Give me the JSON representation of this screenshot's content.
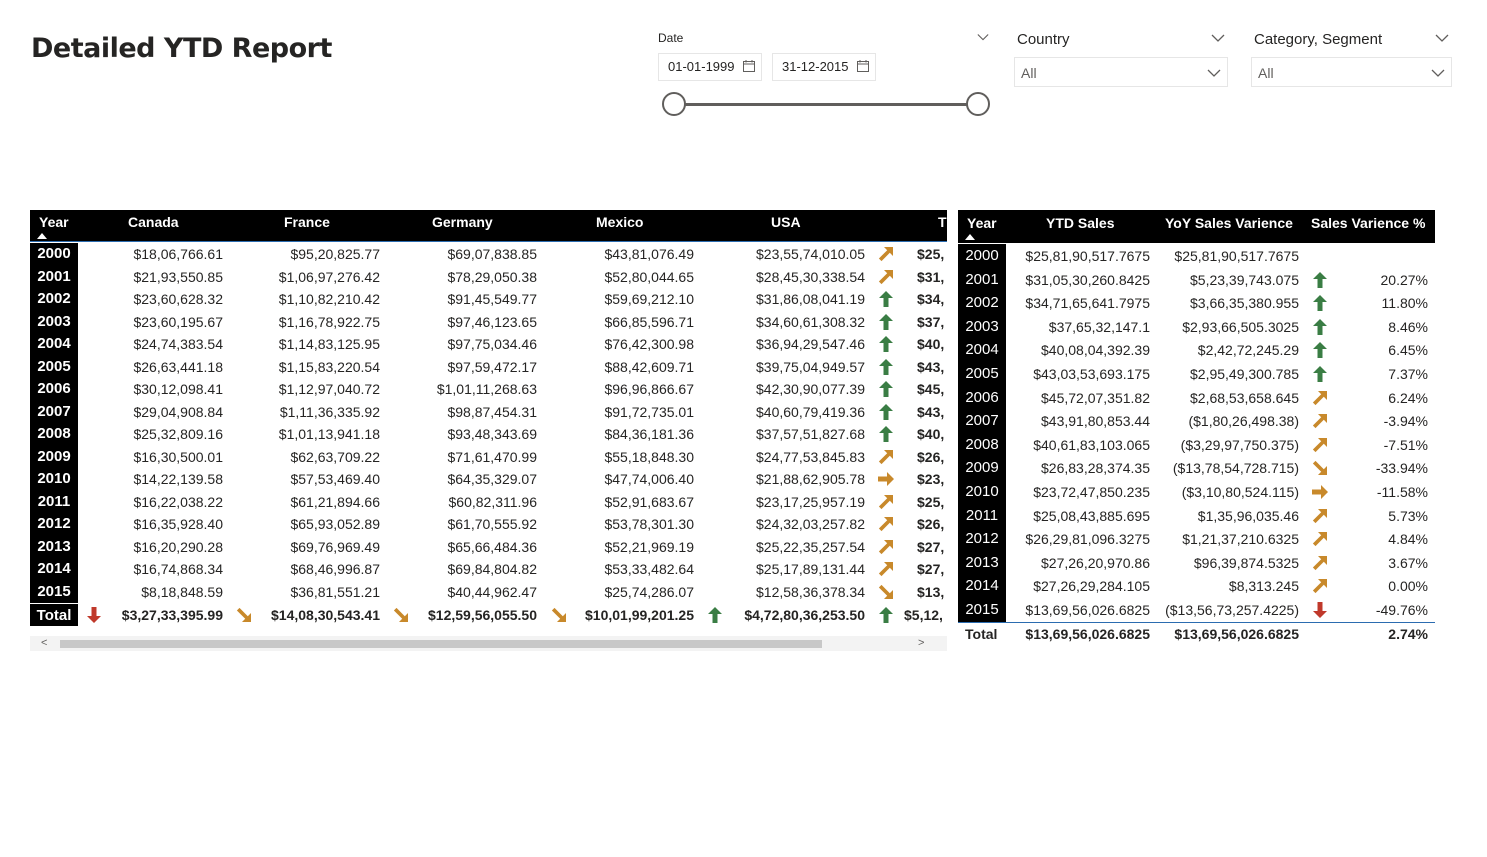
{
  "page_title": "Detailed YTD Report",
  "date_slicer": {
    "label": "Date",
    "start": "01-01-1999",
    "end": "31-12-2015"
  },
  "country_slicer": {
    "label": "Country",
    "value": "All"
  },
  "category_slicer": {
    "label": "Category, Segment",
    "value": "All"
  },
  "matrix": {
    "headers": [
      "Year",
      "Canada",
      "France",
      "Germany",
      "Mexico",
      "USA",
      "T"
    ],
    "rows": [
      {
        "year": "2000",
        "canada": "$18,06,766.61",
        "france": "$95,20,825.77",
        "germany": "$69,07,838.85",
        "mexico": "$43,81,076.49",
        "usa": "$23,55,74,010.05",
        "usa_arrow": "up-right",
        "total": "$25,"
      },
      {
        "year": "2001",
        "canada": "$21,93,550.85",
        "france": "$1,06,97,276.42",
        "germany": "$78,29,050.38",
        "mexico": "$52,80,044.65",
        "usa": "$28,45,30,338.54",
        "usa_arrow": "up-right",
        "total": "$31,"
      },
      {
        "year": "2002",
        "canada": "$23,60,628.32",
        "france": "$1,10,82,210.42",
        "germany": "$91,45,549.77",
        "mexico": "$59,69,212.10",
        "usa": "$31,86,08,041.19",
        "usa_arrow": "up",
        "total": "$34,"
      },
      {
        "year": "2003",
        "canada": "$23,60,195.67",
        "france": "$1,16,78,922.75",
        "germany": "$97,46,123.65",
        "mexico": "$66,85,596.71",
        "usa": "$34,60,61,308.32",
        "usa_arrow": "up",
        "total": "$37,"
      },
      {
        "year": "2004",
        "canada": "$24,74,383.54",
        "france": "$1,14,83,125.95",
        "germany": "$97,75,034.46",
        "mexico": "$76,42,300.98",
        "usa": "$36,94,29,547.46",
        "usa_arrow": "up",
        "total": "$40,"
      },
      {
        "year": "2005",
        "canada": "$26,63,441.18",
        "france": "$1,15,83,220.54",
        "germany": "$97,59,472.17",
        "mexico": "$88,42,609.71",
        "usa": "$39,75,04,949.57",
        "usa_arrow": "up",
        "total": "$43,"
      },
      {
        "year": "2006",
        "canada": "$30,12,098.41",
        "france": "$1,12,97,040.72",
        "germany": "$1,01,11,268.63",
        "mexico": "$96,96,866.67",
        "usa": "$42,30,90,077.39",
        "usa_arrow": "up",
        "total": "$45,"
      },
      {
        "year": "2007",
        "canada": "$29,04,908.84",
        "france": "$1,11,36,335.92",
        "germany": "$98,87,454.31",
        "mexico": "$91,72,735.01",
        "usa": "$40,60,79,419.36",
        "usa_arrow": "up",
        "total": "$43,"
      },
      {
        "year": "2008",
        "canada": "$25,32,809.16",
        "france": "$1,01,13,941.18",
        "germany": "$93,48,343.69",
        "mexico": "$84,36,181.36",
        "usa": "$37,57,51,827.68",
        "usa_arrow": "up",
        "total": "$40,"
      },
      {
        "year": "2009",
        "canada": "$16,30,500.01",
        "france": "$62,63,709.22",
        "germany": "$71,61,470.99",
        "mexico": "$55,18,848.30",
        "usa": "$24,77,53,845.83",
        "usa_arrow": "up-right",
        "total": "$26,"
      },
      {
        "year": "2010",
        "canada": "$14,22,139.58",
        "france": "$57,53,469.40",
        "germany": "$64,35,329.07",
        "mexico": "$47,74,006.40",
        "usa": "$21,88,62,905.78",
        "usa_arrow": "right",
        "total": "$23,"
      },
      {
        "year": "2011",
        "canada": "$16,22,038.22",
        "france": "$61,21,894.66",
        "germany": "$60,82,311.96",
        "mexico": "$52,91,683.67",
        "usa": "$23,17,25,957.19",
        "usa_arrow": "up-right",
        "total": "$25,"
      },
      {
        "year": "2012",
        "canada": "$16,35,928.40",
        "france": "$65,93,052.89",
        "germany": "$61,70,555.92",
        "mexico": "$53,78,301.30",
        "usa": "$24,32,03,257.82",
        "usa_arrow": "up-right",
        "total": "$26,"
      },
      {
        "year": "2013",
        "canada": "$16,20,290.28",
        "france": "$69,76,969.49",
        "germany": "$65,66,484.36",
        "mexico": "$52,21,969.19",
        "usa": "$25,22,35,257.54",
        "usa_arrow": "up-right",
        "total": "$27,"
      },
      {
        "year": "2014",
        "canada": "$16,74,868.34",
        "france": "$68,46,996.87",
        "germany": "$69,84,804.82",
        "mexico": "$53,33,482.64",
        "usa": "$25,17,89,131.44",
        "usa_arrow": "up-right",
        "total": "$27,"
      },
      {
        "year": "2015",
        "canada": "$8,18,848.59",
        "france": "$36,81,551.21",
        "germany": "$40,44,962.47",
        "mexico": "$25,74,286.07",
        "usa": "$12,58,36,378.34",
        "usa_arrow": "down-right",
        "total": "$13,"
      }
    ],
    "total_row": {
      "label": "Total",
      "canada": "$3,27,33,395.99",
      "canada_arrow": "down",
      "france": "$14,08,30,543.41",
      "france_arrow": "down-right",
      "germany": "$12,59,56,055.50",
      "germany_arrow": "down-right",
      "mexico": "$10,01,99,201.25",
      "mexico_arrow": "down-right",
      "usa": "$4,72,80,36,253.50",
      "usa_arrow": "up",
      "total": "$5,12,",
      "total_arrow": "up"
    }
  },
  "ytd_table": {
    "headers": [
      "Year",
      "YTD Sales",
      "YoY Sales Varience",
      "Sales Varience %"
    ],
    "rows": [
      {
        "year": "2000",
        "ytd": "$25,81,90,517.7675",
        "yoy": "$25,81,90,517.7675",
        "arrow": "",
        "pct": ""
      },
      {
        "year": "2001",
        "ytd": "$31,05,30,260.8425",
        "yoy": "$5,23,39,743.075",
        "arrow": "up",
        "pct": "20.27%"
      },
      {
        "year": "2002",
        "ytd": "$34,71,65,641.7975",
        "yoy": "$3,66,35,380.955",
        "arrow": "up",
        "pct": "11.80%"
      },
      {
        "year": "2003",
        "ytd": "$37,65,32,147.1",
        "yoy": "$2,93,66,505.3025",
        "arrow": "up",
        "pct": "8.46%"
      },
      {
        "year": "2004",
        "ytd": "$40,08,04,392.39",
        "yoy": "$2,42,72,245.29",
        "arrow": "up",
        "pct": "6.45%"
      },
      {
        "year": "2005",
        "ytd": "$43,03,53,693.175",
        "yoy": "$2,95,49,300.785",
        "arrow": "up",
        "pct": "7.37%"
      },
      {
        "year": "2006",
        "ytd": "$45,72,07,351.82",
        "yoy": "$2,68,53,658.645",
        "arrow": "up-right",
        "pct": "6.24%"
      },
      {
        "year": "2007",
        "ytd": "$43,91,80,853.44",
        "yoy": "($1,80,26,498.38)",
        "arrow": "up-right",
        "pct": "-3.94%"
      },
      {
        "year": "2008",
        "ytd": "$40,61,83,103.065",
        "yoy": "($3,29,97,750.375)",
        "arrow": "up-right",
        "pct": "-7.51%"
      },
      {
        "year": "2009",
        "ytd": "$26,83,28,374.35",
        "yoy": "($13,78,54,728.715)",
        "arrow": "down-right",
        "pct": "-33.94%"
      },
      {
        "year": "2010",
        "ytd": "$23,72,47,850.235",
        "yoy": "($3,10,80,524.115)",
        "arrow": "right",
        "pct": "-11.58%"
      },
      {
        "year": "2011",
        "ytd": "$25,08,43,885.695",
        "yoy": "$1,35,96,035.46",
        "arrow": "up-right",
        "pct": "5.73%"
      },
      {
        "year": "2012",
        "ytd": "$26,29,81,096.3275",
        "yoy": "$1,21,37,210.6325",
        "arrow": "up-right",
        "pct": "4.84%"
      },
      {
        "year": "2013",
        "ytd": "$27,26,20,970.86",
        "yoy": "$96,39,874.5325",
        "arrow": "up-right",
        "pct": "3.67%"
      },
      {
        "year": "2014",
        "ytd": "$27,26,29,284.105",
        "yoy": "$8,313.245",
        "arrow": "up-right",
        "pct": "0.00%"
      },
      {
        "year": "2015",
        "ytd": "$13,69,56,026.6825",
        "yoy": "($13,56,73,257.4225)",
        "arrow": "down",
        "pct": "-49.76%"
      }
    ],
    "total_row": {
      "label": "Total",
      "ytd": "$13,69,56,026.6825",
      "yoy": "$13,69,56,026.6825",
      "pct": "2.74%"
    }
  },
  "colors": {
    "up": "#3a7d44",
    "up-right": "#c8892b",
    "right": "#c8892b",
    "down-right": "#c8892b",
    "down": "#c0392b",
    "header_bg": "#000000"
  }
}
